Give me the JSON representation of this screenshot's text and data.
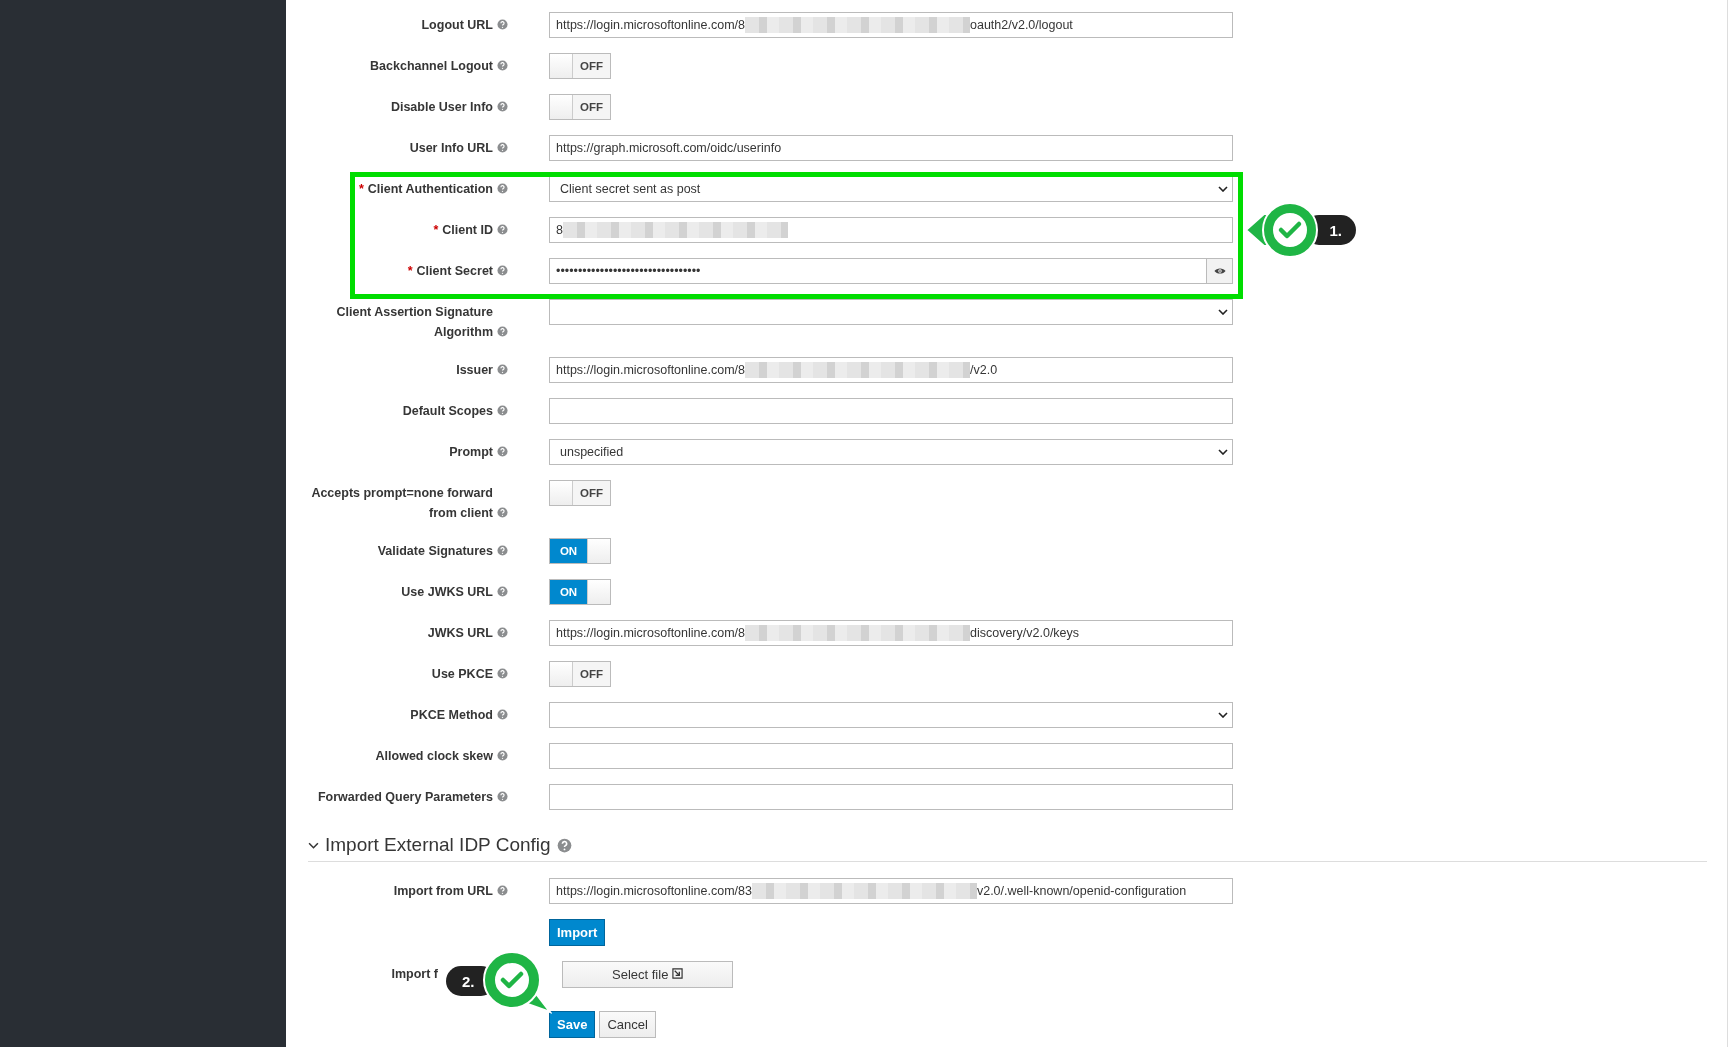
{
  "fields": [
    {
      "kind": "text",
      "label": "Logout URL",
      "value_start": "https://login.microsoftonline.com/8",
      "redacted": true,
      "value_end": "oauth2/v2.0/logout"
    },
    {
      "kind": "toggle",
      "label": "Backchannel Logout",
      "on": false,
      "state_text": "OFF"
    },
    {
      "kind": "toggle",
      "label": "Disable User Info",
      "on": false,
      "state_text": "OFF"
    },
    {
      "kind": "text",
      "label": "User Info URL",
      "value_start": "https://graph.microsoft.com/oidc/userinfo"
    },
    {
      "kind": "select",
      "label": "Client Authentication",
      "required_mark": "*",
      "value": "Client secret sent as post"
    },
    {
      "kind": "text",
      "label": "Client ID",
      "required_mark": "*",
      "value_start": "8",
      "redacted": true
    },
    {
      "kind": "password",
      "label": "Client Secret",
      "required_mark": "*",
      "value": "•••••••••••••••••••••••••••••••••"
    },
    {
      "kind": "select",
      "label": "Client Assertion Signature Algorithm"
    },
    {
      "kind": "text",
      "label": "Issuer",
      "value_start": "https://login.microsoftonline.com/8",
      "redacted": true,
      "value_end": "/v2.0"
    },
    {
      "kind": "text",
      "label": "Default Scopes"
    },
    {
      "kind": "select",
      "label": "Prompt",
      "value": "unspecified"
    },
    {
      "kind": "toggle",
      "label": "Accepts prompt=none forward from client",
      "on": false,
      "state_text": "OFF"
    },
    {
      "kind": "toggle",
      "label": "Validate Signatures",
      "on": true,
      "state_text": "ON"
    },
    {
      "kind": "toggle",
      "label": "Use JWKS URL",
      "on": true,
      "state_text": "ON"
    },
    {
      "kind": "text",
      "label": "JWKS URL",
      "value_start": "https://login.microsoftonline.com/8",
      "redacted": true,
      "value_end": "discovery/v2.0/keys"
    },
    {
      "kind": "toggle",
      "label": "Use PKCE",
      "on": false,
      "state_text": "OFF"
    },
    {
      "kind": "select",
      "label": "PKCE Method"
    },
    {
      "kind": "text",
      "label": "Allowed clock skew"
    },
    {
      "kind": "text",
      "label": "Forwarded Query Parameters"
    }
  ],
  "section": {
    "title": "Import External IDP Config",
    "expanded": true
  },
  "import_url": {
    "label": "Import from URL",
    "value_start": "https://login.microsoftonline.com/83",
    "redacted": true,
    "value_end": "v2.0/.well-known/openid-configuration"
  },
  "import_button": "Import",
  "import_file": {
    "label": "Import f",
    "button": "Select file"
  },
  "buttons": [
    "Save",
    "Cancel"
  ],
  "callouts": [
    "1.",
    "2."
  ]
}
